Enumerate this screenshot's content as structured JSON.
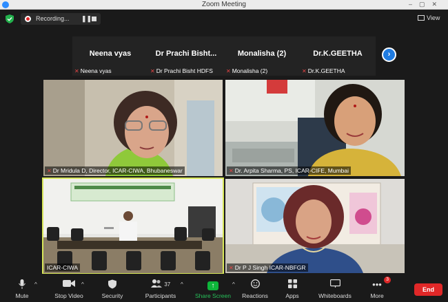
{
  "window": {
    "title": "Zoom Meeting"
  },
  "recording": {
    "label": "Recording..."
  },
  "view": {
    "label": "View"
  },
  "strip": [
    {
      "display_name": "Neena vyas",
      "name_label": "Neena vyas"
    },
    {
      "display_name": "Dr Prachi Bisht...",
      "name_label": "Dr Prachi Bisht HDFS"
    },
    {
      "display_name": "Monalisha (2)",
      "name_label": "Monalisha (2)"
    },
    {
      "display_name": "Dr.K.GEETHA",
      "name_label": "Dr.K.GEETHA"
    }
  ],
  "videos": [
    {
      "label": "Dr Mridula D, Director, ICAR-CIWA, Bhubaneswar"
    },
    {
      "label": "Dr. Arpita Sharma, PS, ICAR-CIFE, Mumbai"
    },
    {
      "label": "ICAR-CIWA"
    },
    {
      "label": "Dr P J Singh ICAR-NBFGR"
    }
  ],
  "toolbar": {
    "mute": "Mute",
    "stop_video": "Stop Video",
    "security": "Security",
    "participants": "Participants",
    "participants_count": "37",
    "share_screen": "Share Screen",
    "reactions": "Reactions",
    "apps": "Apps",
    "whiteboards": "Whiteboards",
    "more": "More",
    "more_badge": "3",
    "end": "End"
  },
  "colors": {
    "accent": "#2d8cff",
    "share_green": "#0eb53a",
    "end_red": "#e02828",
    "active_speaker": "#d9e85a"
  }
}
